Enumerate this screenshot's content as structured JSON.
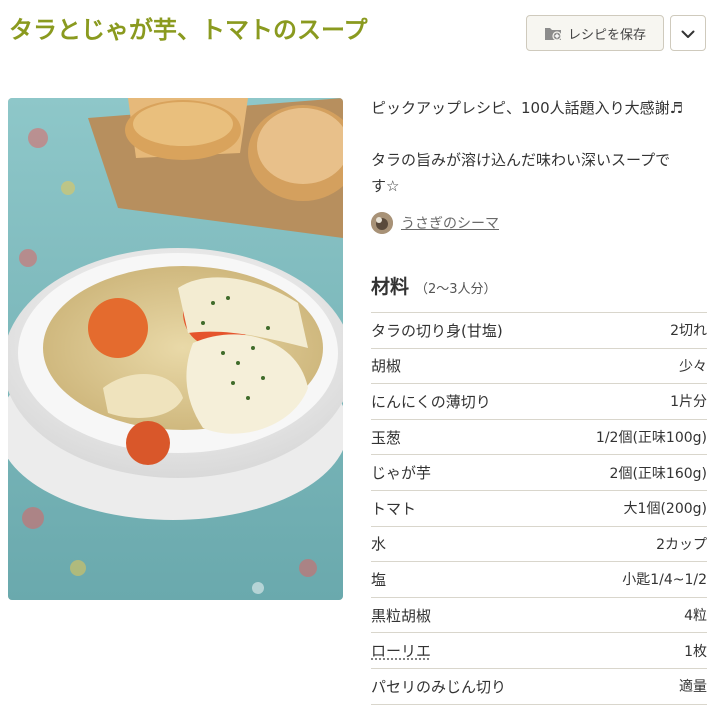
{
  "recipe": {
    "title": "タラとじゃが芋、トマトのスープ",
    "save_label": "レシピを保存",
    "description_lines": [
      "ピックアップレシピ、100人話題入り大感謝♬",
      "",
      "タラの旨みが溶け込んだ味わい深いスープで",
      "す☆"
    ],
    "author": "うさぎのシーマ"
  },
  "ingredients": {
    "heading": "材料",
    "servings": "（2～3人分）",
    "items": [
      {
        "name": "タラの切り身(甘塩)",
        "qty": "2切れ"
      },
      {
        "name": "胡椒",
        "qty": "少々"
      },
      {
        "name": "にんにくの薄切り",
        "qty": "1片分"
      },
      {
        "name": "玉葱",
        "qty": "1/2個(正味100g)"
      },
      {
        "name": "じゃが芋",
        "qty": "2個(正味160g)"
      },
      {
        "name": "トマト",
        "qty": "大1個(200g)"
      },
      {
        "name": "水",
        "qty": "2カップ"
      },
      {
        "name": "塩",
        "qty": "小匙1/4~1/2"
      },
      {
        "name": "黒粒胡椒",
        "qty": "4粒"
      },
      {
        "name": "ローリエ",
        "qty": "1枚",
        "linked": true
      },
      {
        "name": "パセリのみじん切り",
        "qty": "適量"
      }
    ]
  },
  "colors": {
    "title": "#8a9a1f",
    "border": "#d9d6cc"
  },
  "icons": {
    "save": "folder-plus-icon",
    "dropdown": "chevron-down-icon"
  }
}
